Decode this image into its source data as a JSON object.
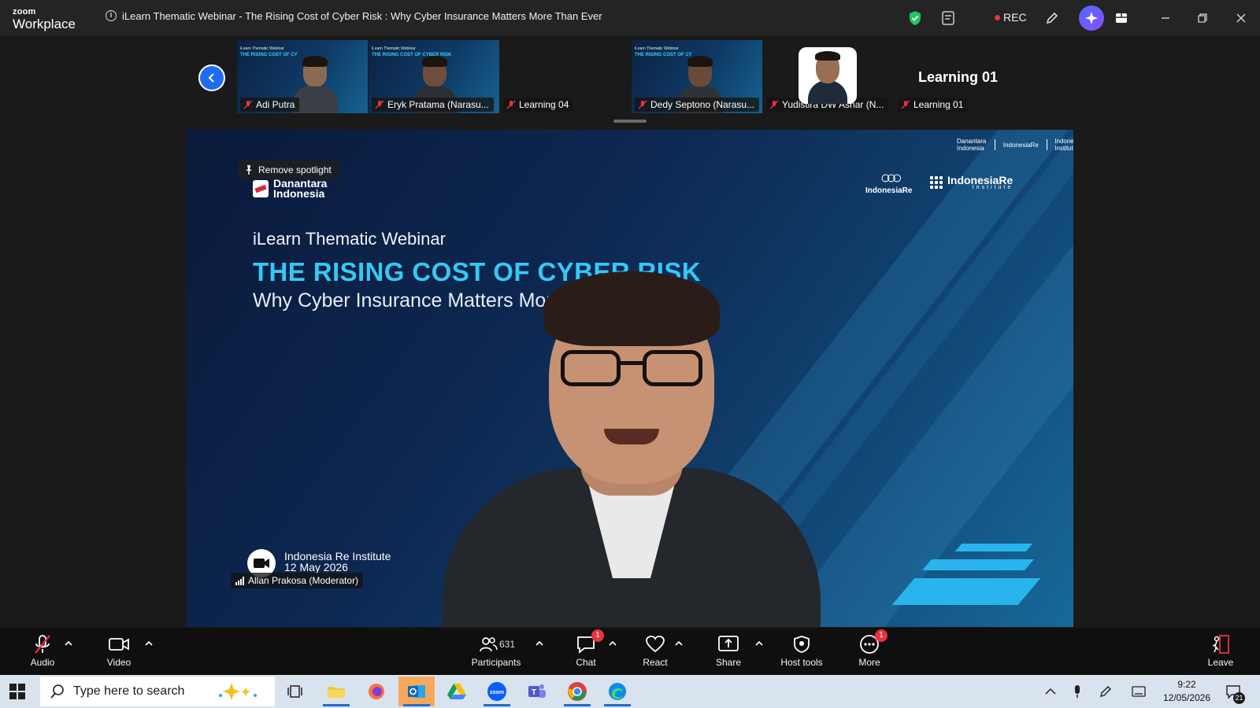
{
  "app": {
    "brand_top": "zoom",
    "brand_bottom": "Workplace",
    "meeting_title": "iLearn Thematic Webinar - The Rising Cost of Cyber Risk : Why Cyber Insurance Matters More Than Ever",
    "rec_label": "REC"
  },
  "gallery": {
    "tiles": [
      {
        "name": "Adi Putra",
        "muted": true,
        "video": "slide"
      },
      {
        "name": "Eryk Pratama (Narasu...",
        "muted": true,
        "video": "slide"
      },
      {
        "name": "Learning 04",
        "muted": true,
        "video": "off"
      },
      {
        "name": "Dedy Septono (Narasu...",
        "muted": true,
        "video": "slide"
      },
      {
        "name": "Yudistira DW Asnar (N...",
        "muted": true,
        "video": "photo"
      },
      {
        "name": "Learning 01",
        "muted": true,
        "video": "off"
      }
    ],
    "tile_large_label": "Learning 01"
  },
  "main": {
    "spotlight_label": "Remove spotlight",
    "slide": {
      "logo_text_line1": "Danantara",
      "logo_text_line2": "Indonesia",
      "logo_ire": "IndonesiaRe",
      "logo_iri": "IndonesiaRe",
      "logo_iri_sub": "Institute",
      "eyebrow": "iLearn Thematic Webinar",
      "headline": "THE RISING COST OF CYBER RISK",
      "subheadline": "Why Cyber Insurance Matters More Than Ever",
      "top_right_logos": [
        "Danantara Indonesia",
        "IndonesiaRe",
        "IndonesiaRe Institute"
      ]
    },
    "org_name": "Indonesia Re Institute",
    "date": "12 May 2026",
    "speaker_name": "Allan Prakosa (Moderator)"
  },
  "controls": {
    "audio": "Audio",
    "video": "Video",
    "participants": "Participants",
    "participants_count": "631",
    "chat": "Chat",
    "chat_badge": "1",
    "react": "React",
    "share": "Share",
    "host_tools": "Host tools",
    "more": "More",
    "more_badge": "1",
    "leave": "Leave"
  },
  "taskbar": {
    "search_placeholder": "Type here to search",
    "time": "9:22",
    "date": "12/05/2026",
    "notification_count": "21"
  },
  "colors": {
    "accent_blue": "#1d6cf2",
    "slide_headline": "#36c8f5",
    "rec_red": "#e8323c",
    "leave_red": "#e8323c"
  }
}
